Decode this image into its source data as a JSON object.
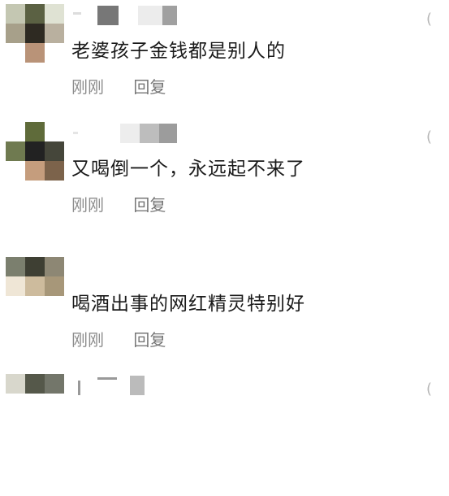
{
  "comments": [
    {
      "text": "老婆孩子金钱都是别人的",
      "time": "刚刚",
      "reply": "回复"
    },
    {
      "text": "又喝倒一个，永远起不来了",
      "time": "刚刚",
      "reply": "回复"
    },
    {
      "text": "喝酒出事的网红精灵特别好",
      "time": "刚刚",
      "reply": "回复"
    }
  ],
  "icons": {
    "like": "like-icon"
  }
}
